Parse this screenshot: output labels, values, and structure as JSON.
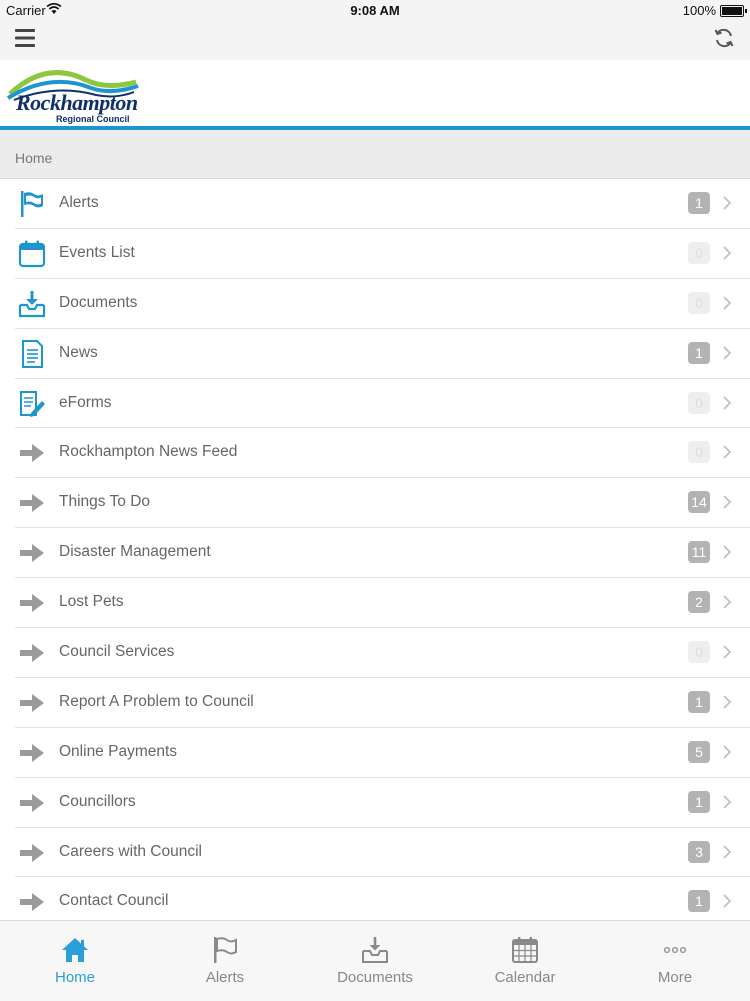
{
  "status_bar": {
    "carrier": "Carrier",
    "time": "9:08 AM",
    "battery": "100%"
  },
  "logo": {
    "name": "Rockhampton",
    "subtitle": "Regional Council"
  },
  "breadcrumb": "Home",
  "menu_items": [
    {
      "label": "Alerts",
      "badge": "1",
      "icon": "flag-icon"
    },
    {
      "label": "Events List",
      "badge": "0",
      "icon": "calendar-icon"
    },
    {
      "label": "Documents",
      "badge": "0",
      "icon": "inbox-download-icon"
    },
    {
      "label": "News",
      "badge": "1",
      "icon": "document-icon"
    },
    {
      "label": "eForms",
      "badge": "0",
      "icon": "form-pencil-icon"
    },
    {
      "label": "Rockhampton News Feed",
      "badge": "0",
      "icon": "arrow-right-icon"
    },
    {
      "label": "Things To Do",
      "badge": "14",
      "icon": "arrow-right-icon"
    },
    {
      "label": "Disaster Management",
      "badge": "11",
      "icon": "arrow-right-icon"
    },
    {
      "label": "Lost Pets",
      "badge": "2",
      "icon": "arrow-right-icon"
    },
    {
      "label": "Council Services",
      "badge": "0",
      "icon": "arrow-right-icon"
    },
    {
      "label": "Report A Problem to Council",
      "badge": "1",
      "icon": "arrow-right-icon"
    },
    {
      "label": "Online Payments",
      "badge": "5",
      "icon": "arrow-right-icon"
    },
    {
      "label": "Councillors",
      "badge": "1",
      "icon": "arrow-right-icon"
    },
    {
      "label": "Careers with Council",
      "badge": "3",
      "icon": "arrow-right-icon"
    },
    {
      "label": "Contact Council",
      "badge": "1",
      "icon": "arrow-right-icon"
    }
  ],
  "tabs": [
    {
      "label": "Home",
      "icon": "home-icon",
      "active": true
    },
    {
      "label": "Alerts",
      "icon": "flag-icon",
      "active": false
    },
    {
      "label": "Documents",
      "icon": "inbox-download-icon",
      "active": false
    },
    {
      "label": "Calendar",
      "icon": "calendar-grid-icon",
      "active": false
    },
    {
      "label": "More",
      "icon": "more-dots-icon",
      "active": false
    }
  ],
  "colors": {
    "accent": "#2a9fd8",
    "badge": "#b3b3b3",
    "badge_zero": "#eeeeee",
    "rule": "#1f95cf"
  }
}
